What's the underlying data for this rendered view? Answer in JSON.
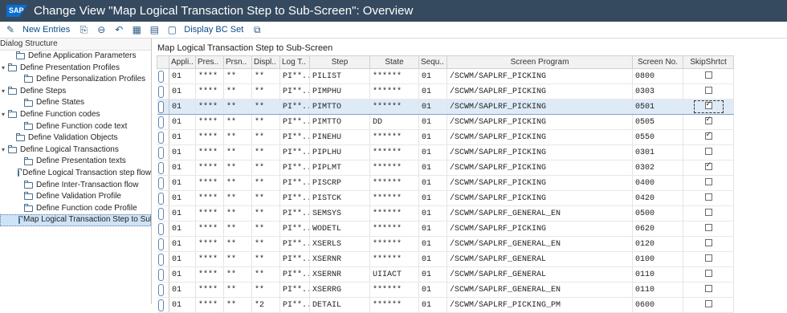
{
  "window": {
    "title": "Change View \"Map Logical Transaction Step to Sub-Screen\": Overview",
    "logo_text": "SAP"
  },
  "toolbar": {
    "new_entries": "New Entries",
    "display_bc_set": "Display BC Set"
  },
  "tree": {
    "header": "Dialog Structure",
    "items": [
      {
        "label": "Define Application Parameters",
        "level": 1,
        "caret": ""
      },
      {
        "label": "Define Presentation Profiles",
        "level": 0,
        "caret": "▾"
      },
      {
        "label": "Define Personalization Profiles",
        "level": 2,
        "caret": ""
      },
      {
        "label": "Define Steps",
        "level": 0,
        "caret": "▾"
      },
      {
        "label": "Define States",
        "level": 2,
        "caret": ""
      },
      {
        "label": "Define Function codes",
        "level": 0,
        "caret": "▾"
      },
      {
        "label": "Define Function code text",
        "level": 2,
        "caret": ""
      },
      {
        "label": "Define Validation Objects",
        "level": 1,
        "caret": ""
      },
      {
        "label": "Define Logical Transactions",
        "level": 0,
        "caret": "▾"
      },
      {
        "label": "Define Presentation texts",
        "level": 2,
        "caret": ""
      },
      {
        "label": "Define Logical Transaction step flow",
        "level": 2,
        "caret": ""
      },
      {
        "label": "Define Inter-Transaction flow",
        "level": 2,
        "caret": ""
      },
      {
        "label": "Define Validation Profile",
        "level": 2,
        "caret": ""
      },
      {
        "label": "Define Function code Profile",
        "level": 2,
        "caret": ""
      },
      {
        "label": "Map Logical Transaction Step to Sub",
        "level": 2,
        "caret": "",
        "selected": true
      }
    ]
  },
  "pane": {
    "title": "Map Logical Transaction Step to Sub-Screen",
    "columns": [
      "Appli..",
      "Pres..",
      "Prsn..",
      "Displ..",
      "Log T..",
      "Step",
      "State",
      "Sequ..",
      "Screen Program",
      "Screen No.",
      "SkipShrtct"
    ],
    "rows": [
      [
        "01",
        "****",
        "**",
        "**",
        "PI**..",
        "PILIST",
        "******",
        "01",
        "/SCWM/SAPLRF_PICKING",
        "0800",
        false
      ],
      [
        "01",
        "****",
        "**",
        "**",
        "PI**..",
        "PIMPHU",
        "******",
        "01",
        "/SCWM/SAPLRF_PICKING",
        "0303",
        false
      ],
      [
        "01",
        "****",
        "**",
        "**",
        "PI**..",
        "PIMTTO",
        "******",
        "01",
        "/SCWM/SAPLRF_PICKING",
        "0501",
        true
      ],
      [
        "01",
        "****",
        "**",
        "**",
        "PI**..",
        "PIMTTO",
        "DD",
        "01",
        "/SCWM/SAPLRF_PICKING",
        "0505",
        true
      ],
      [
        "01",
        "****",
        "**",
        "**",
        "PI**..",
        "PINEHU",
        "******",
        "01",
        "/SCWM/SAPLRF_PICKING",
        "0550",
        true
      ],
      [
        "01",
        "****",
        "**",
        "**",
        "PI**..",
        "PIPLHU",
        "******",
        "01",
        "/SCWM/SAPLRF_PICKING",
        "0301",
        false
      ],
      [
        "01",
        "****",
        "**",
        "**",
        "PI**..",
        "PIPLMT",
        "******",
        "01",
        "/SCWM/SAPLRF_PICKING",
        "0302",
        true
      ],
      [
        "01",
        "****",
        "**",
        "**",
        "PI**..",
        "PISCRP",
        "******",
        "01",
        "/SCWM/SAPLRF_PICKING",
        "0400",
        false
      ],
      [
        "01",
        "****",
        "**",
        "**",
        "PI**..",
        "PISTCK",
        "******",
        "01",
        "/SCWM/SAPLRF_PICKING",
        "0420",
        false
      ],
      [
        "01",
        "****",
        "**",
        "**",
        "PI**..",
        "SEMSYS",
        "******",
        "01",
        "/SCWM/SAPLRF_GENERAL_EN",
        "0500",
        false
      ],
      [
        "01",
        "****",
        "**",
        "**",
        "PI**..",
        "WODETL",
        "******",
        "01",
        "/SCWM/SAPLRF_PICKING",
        "0620",
        false
      ],
      [
        "01",
        "****",
        "**",
        "**",
        "PI**..",
        "XSERLS",
        "******",
        "01",
        "/SCWM/SAPLRF_GENERAL_EN",
        "0120",
        false
      ],
      [
        "01",
        "****",
        "**",
        "**",
        "PI**..",
        "XSERNR",
        "******",
        "01",
        "/SCWM/SAPLRF_GENERAL",
        "0100",
        false
      ],
      [
        "01",
        "****",
        "**",
        "**",
        "PI**..",
        "XSERNR",
        "UIIACT",
        "01",
        "/SCWM/SAPLRF_GENERAL",
        "0110",
        false
      ],
      [
        "01",
        "****",
        "**",
        "**",
        "PI**..",
        "XSERRG",
        "******",
        "01",
        "/SCWM/SAPLRF_GENERAL_EN",
        "0110",
        false
      ],
      [
        "01",
        "****",
        "**",
        "*2",
        "PI**..",
        "DETAIL",
        "******",
        "01",
        "/SCWM/SAPLRF_PICKING_PM",
        "0600",
        false
      ]
    ],
    "selected_row": 2
  },
  "colors": {
    "titlebar": "#354a5f",
    "selection": "#deebf7",
    "link": "#0a4b8a"
  }
}
